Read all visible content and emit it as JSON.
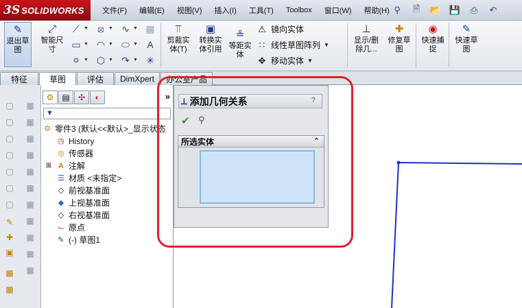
{
  "app": {
    "logo_ds": "3S",
    "logo_name": "SOLIDWORKS"
  },
  "menu": [
    "文件(F)",
    "编辑(E)",
    "视图(V)",
    "插入(I)",
    "工具(T)",
    "Toolbox",
    "窗口(W)",
    "帮助(H)"
  ],
  "toolbar": {
    "exit_sketch": "退出草\n图",
    "smart_dim": "智能尺\n寸",
    "trim": "剪裁实\n体(T)",
    "convert": "转换实\n体引用",
    "offset": "等距实\n体",
    "mirror": "镜向实体",
    "linear_pattern": "线性草图阵列",
    "move": "移动实体",
    "show_delete": "显示/删\n除几...",
    "repair": "修复草\n图",
    "quick_snap": "快速捕\n捉",
    "rapid_sketch": "快速草\n图"
  },
  "tabs": [
    "特征",
    "草图",
    "评估",
    "DimXpert",
    "办公室产品"
  ],
  "tree": {
    "root": "零件3  (默认<<默认>_显示状态",
    "items": [
      "History",
      "传感器",
      "注解",
      "材质 <未指定>",
      "前视基准面",
      "上视基准面",
      "右视基准面",
      "原点",
      "(-) 草图1"
    ]
  },
  "property_manager": {
    "title": "添加几何关系",
    "help": "?",
    "group_title": "所选实体"
  }
}
